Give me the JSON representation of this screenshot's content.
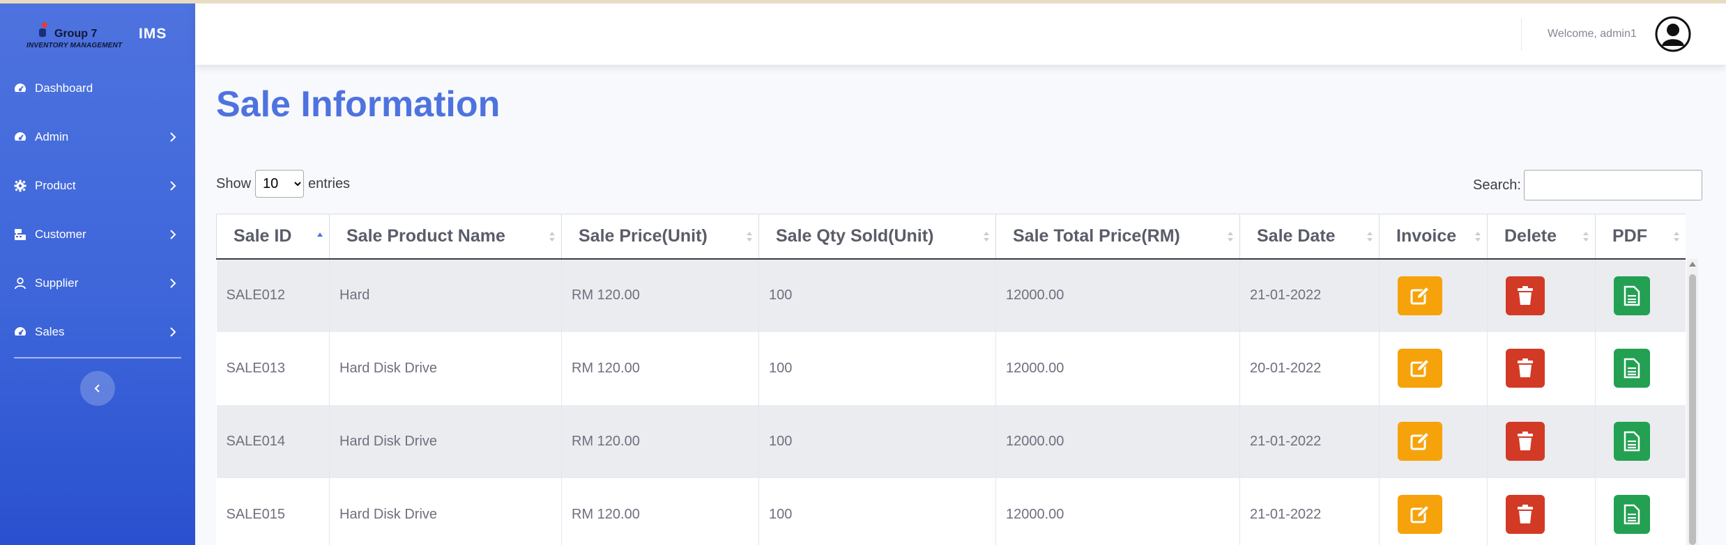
{
  "brand": {
    "title": "Group 7",
    "subtitle": "INVENTORY MANAGEMENT",
    "short": "IMS"
  },
  "sidebar": {
    "items": [
      {
        "label": "Dashboard",
        "icon": "tachometer-icon",
        "has_chevron": false
      },
      {
        "label": "Admin",
        "icon": "tachometer-icon",
        "has_chevron": true
      },
      {
        "label": "Product",
        "icon": "gear-icon",
        "has_chevron": true
      },
      {
        "label": "Customer",
        "icon": "cash-register-icon",
        "has_chevron": true
      },
      {
        "label": "Supplier",
        "icon": "user-icon",
        "has_chevron": true
      },
      {
        "label": "Sales",
        "icon": "tachometer-icon",
        "has_chevron": true
      }
    ],
    "toggle_icon": "chevron-left-icon"
  },
  "topbar": {
    "welcome": "Welcome, admin1",
    "avatar_icon": "user-silhouette-icon"
  },
  "page": {
    "title": "Sale Information"
  },
  "table_controls": {
    "show_label": "Show",
    "entries_label": "entries",
    "length_value": "10",
    "search_label": "Search:"
  },
  "table": {
    "columns": [
      "Sale ID",
      "Sale Product Name",
      "Sale Price(Unit)",
      "Sale Qty Sold(Unit)",
      "Sale Total Price(RM)",
      "Sale Date",
      "Invoice",
      "Delete",
      "PDF"
    ],
    "sorted_column": "Sale ID",
    "rows": [
      {
        "id": "SALE012",
        "name": "Hard",
        "price": "RM 120.00",
        "qty": "100",
        "total": "12000.00",
        "date": "21-01-2022"
      },
      {
        "id": "SALE013",
        "name": "Hard Disk Drive",
        "price": "RM 120.00",
        "qty": "100",
        "total": "12000.00",
        "date": "20-01-2022"
      },
      {
        "id": "SALE014",
        "name": "Hard Disk Drive",
        "price": "RM 120.00",
        "qty": "100",
        "total": "12000.00",
        "date": "21-01-2022"
      },
      {
        "id": "SALE015",
        "name": "Hard Disk Drive",
        "price": "RM 120.00",
        "qty": "100",
        "total": "12000.00",
        "date": "21-01-2022"
      }
    ],
    "action_icons": {
      "invoice": "edit-icon",
      "delete": "trash-icon",
      "pdf": "file-text-icon"
    }
  },
  "colors": {
    "sidebar_top": "#4e73df",
    "sidebar_bottom": "#2a50cf",
    "title": "#4e73df",
    "invoice_button": "#f6a20b",
    "delete_button": "#d33a26",
    "pdf_button": "#23a052"
  }
}
